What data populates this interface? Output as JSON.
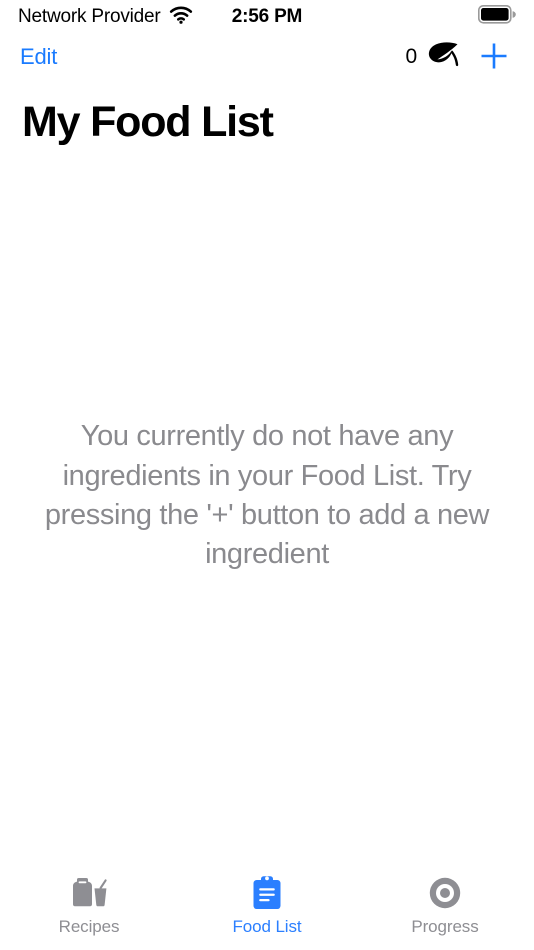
{
  "status_bar": {
    "carrier": "Network Provider",
    "wifi_icon": "wifi-icon",
    "time": "2:56 PM",
    "battery_icon": "battery-full-icon"
  },
  "nav_bar": {
    "edit_label": "Edit",
    "leaf_count": "0",
    "leaf_icon": "leaf-icon",
    "add_icon": "plus-icon"
  },
  "page_title": "My Food List",
  "empty_state": {
    "message": "You currently do not have any ingredients in your Food List. Try pressing the '+' button to add a new ingredient"
  },
  "tab_bar": {
    "tabs": [
      {
        "label": "Recipes",
        "icon": "milk-carton-and-cup-icon",
        "active": false
      },
      {
        "label": "Food List",
        "icon": "clipboard-icon",
        "active": true
      },
      {
        "label": "Progress",
        "icon": "progress-ring-icon",
        "active": false
      }
    ]
  },
  "colors": {
    "accent_blue": "#2b7fff",
    "edit_blue": "#1a7bff",
    "inactive_gray": "#8e8e93",
    "empty_text_gray": "#8a8a8e",
    "background": "#ffffff"
  }
}
